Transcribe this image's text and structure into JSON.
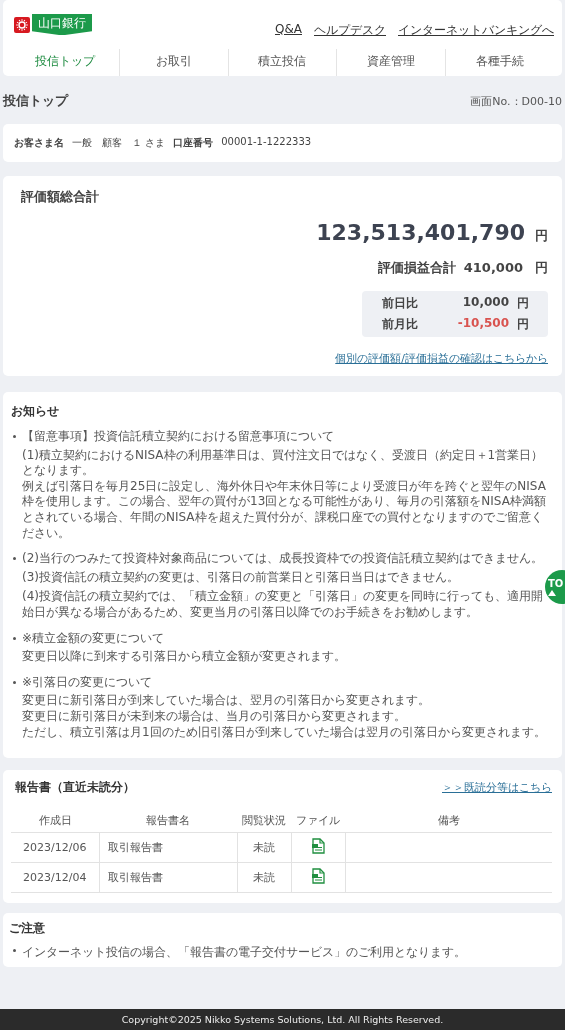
{
  "header": {
    "logo_text": "山口銀行",
    "links": [
      "Q&A",
      "ヘルプデスク",
      "インターネットバンキングへ"
    ]
  },
  "nav": [
    {
      "label": "投信トップ",
      "selected": true
    },
    {
      "label": "お取引",
      "selected": false
    },
    {
      "label": "積立投信",
      "selected": false
    },
    {
      "label": "資産管理",
      "selected": false
    },
    {
      "label": "各種手続",
      "selected": false
    }
  ],
  "page": {
    "title": "投信トップ",
    "screen_no": "画面No.：D00-10"
  },
  "customer": {
    "name_label": "お客さま名",
    "name": "一般　顧客　１ さま",
    "account_label": "口座番号",
    "account": "00001-1-1222333"
  },
  "valuation": {
    "title": "評価額総合計",
    "total": "123,513,401,790",
    "total_unit": "円",
    "pl_label": "評価損益合計",
    "pl": "410,000",
    "pl_unit": "円",
    "changes": [
      {
        "label": "前日比",
        "value": "10,000",
        "unit": "円",
        "negative": false
      },
      {
        "label": "前月比",
        "value": "-10,500",
        "unit": "円",
        "negative": true
      }
    ],
    "link": "個別の評価額/評価損益の確認はこちらから"
  },
  "notices": {
    "title": "お知らせ",
    "items": [
      {
        "title": "【留意事項】投資信託積立契約における留意事項について",
        "paragraphs": [
          [
            "(1)積立契約におけるNISA枠の利用基準日は、買付注文日ではなく、受渡日（約定日＋1営業日）となります。",
            "例えば引落日を毎月25日に設定し、海外休日や年末休日等により受渡日が年を跨ぐと翌年のNISA枠を使用します。この場合、翌年の買付が13回となる可能性があり、毎月の引落額をNISA枠満額とされている場合、年間のNISA枠を超えた買付分が、課税口座での買付となりますのでご留意ください。"
          ]
        ]
      },
      {
        "title": "(2)当行のつみたて投資枠対象商品については、成長投資枠での投資信託積立契約はできません。",
        "paragraphs": [
          [
            "(3)投資信託の積立契約の変更は、引落日の前営業日と引落日当日はできません。"
          ],
          [
            "(4)投資信託の積立契約では、「積立金額」の変更と「引落日」の変更を同時に行っても、適用開始日が異なる場合があるため、変更当月の引落日以降でのお手続きをお勧めします。"
          ]
        ]
      },
      {
        "title": "※積立金額の変更について",
        "paragraphs": [
          [
            "変更日以降に到来する引落日から積立金額が変更されます。"
          ]
        ]
      },
      {
        "title": "※引落日の変更について",
        "paragraphs": [
          [
            "変更日に新引落日が到来していた場合は、翌月の引落日から変更されます。",
            "変更日に新引落日が未到来の場合は、当月の引落日から変更されます。",
            "ただし、積立引落は月1回のため旧引落日が到来していた場合は翌月の引落日から変更されます。"
          ]
        ]
      }
    ]
  },
  "reports": {
    "title": "報告書（直近未読分）",
    "link": "＞＞既読分等はこちら",
    "columns": [
      "作成日",
      "報告書名",
      "閲覧状況",
      "ファイル",
      "備考"
    ],
    "rows": [
      {
        "date": "2023/12/06",
        "name": "取引報告書",
        "status": "未読",
        "file": true
      },
      {
        "date": "2023/12/04",
        "name": "取引報告書",
        "status": "未読",
        "file": true
      }
    ]
  },
  "caution": {
    "title": "ご注意",
    "items": [
      "インターネット投信の場合、「報告書の電子交付サービス」のご利用となります。"
    ]
  },
  "top_button": {
    "label": "TO"
  },
  "footer": "Copyright©2025 Nikko Systems Solutions, Ltd. All Rights Reserved."
}
